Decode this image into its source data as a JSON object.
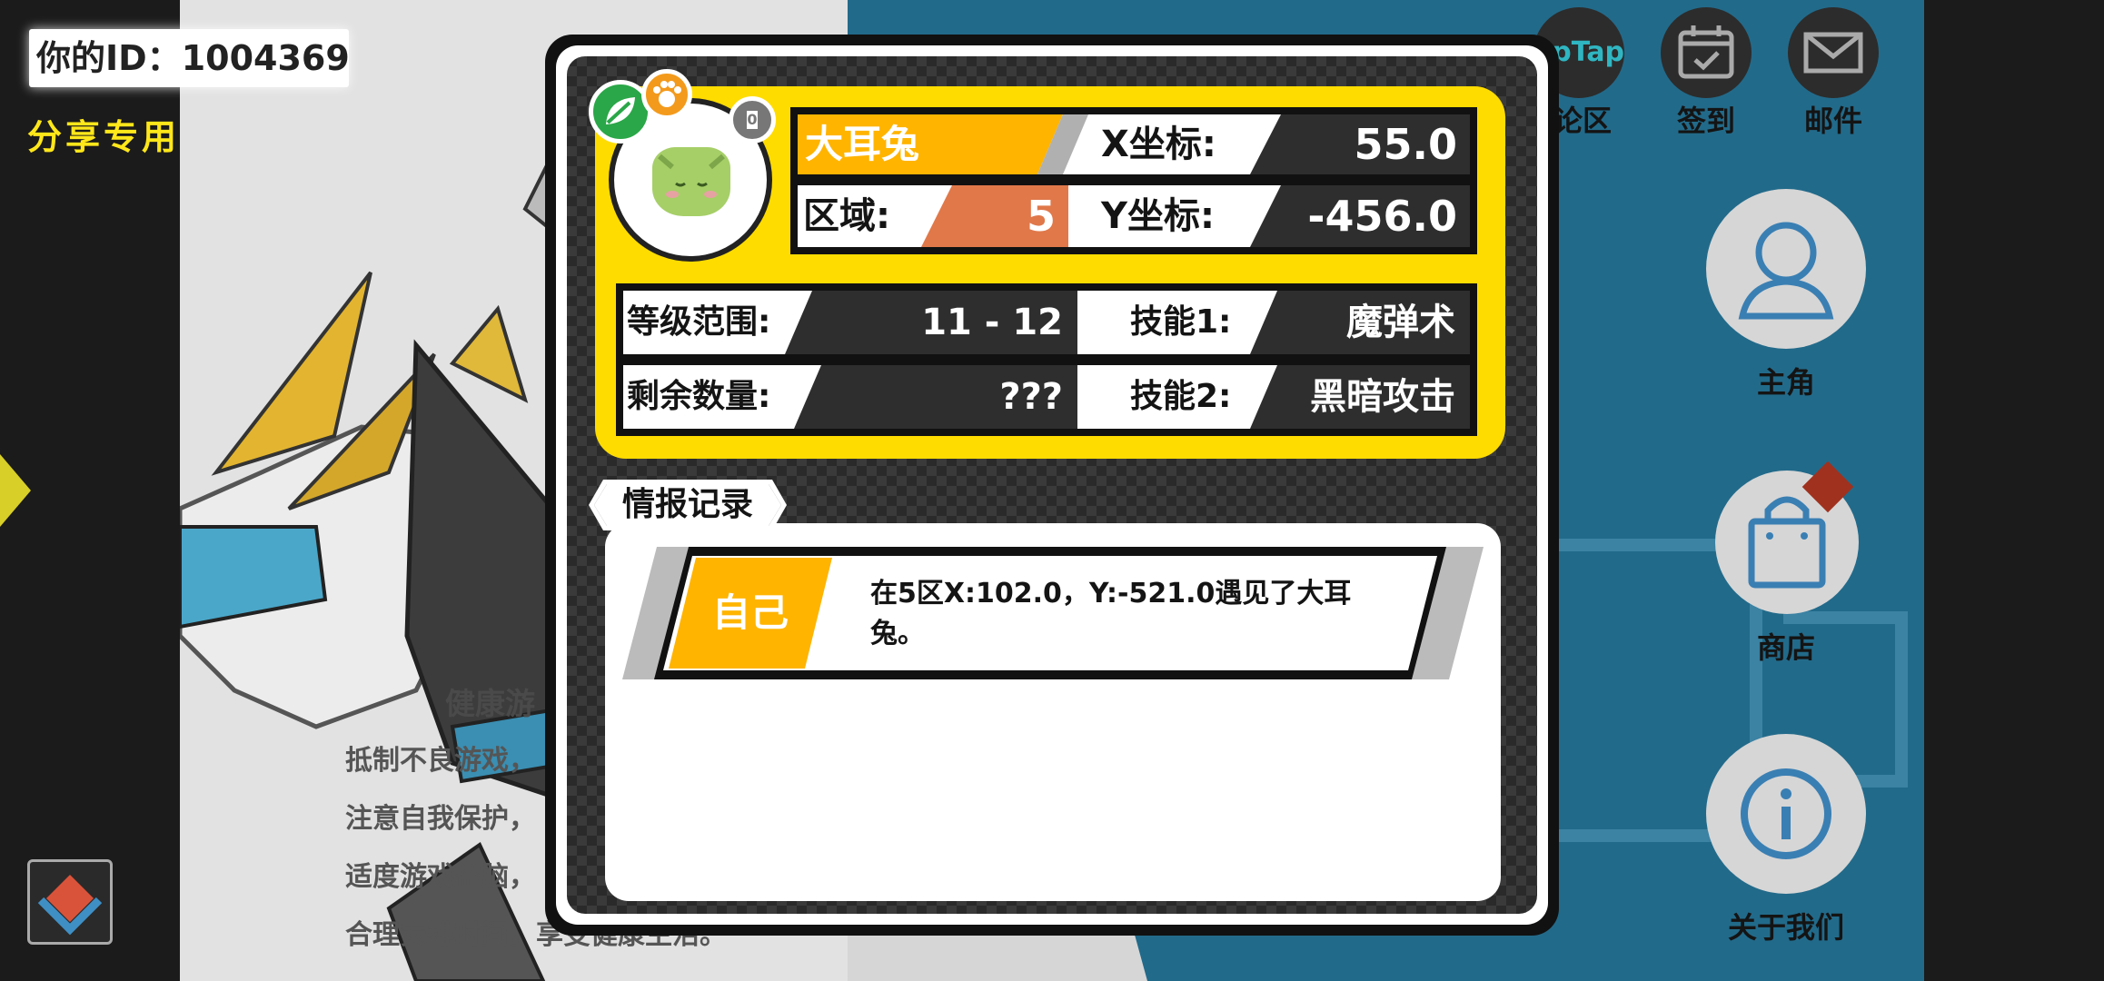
{
  "hud": {
    "player_id_label": "你的ID：",
    "player_id": "1004369",
    "share_label": "分享专用"
  },
  "background": {
    "warning_title": "健康游",
    "warning_lines": [
      "抵制不良游戏，",
      "注意自我保护，",
      "适度游戏益脑，",
      "合理安排时间，享受健康生活。"
    ]
  },
  "top_menu": {
    "items": [
      {
        "label": "论区",
        "icon": "taptap-icon",
        "icon_text": "apTap"
      },
      {
        "label": "签到",
        "icon": "calendar-check-icon"
      },
      {
        "label": "邮件",
        "icon": "mail-icon"
      }
    ]
  },
  "side_menu": {
    "items": [
      {
        "label": "主角",
        "icon": "person-icon"
      },
      {
        "label": "商店",
        "icon": "shopping-bag-icon"
      },
      {
        "label": "关于我们",
        "icon": "info-icon"
      }
    ]
  },
  "monster": {
    "name": "大耳兔",
    "x_label": "X坐标:",
    "x_value": "55.0",
    "region_label": "区域:",
    "region_value": "5",
    "y_label": "Y坐标:",
    "y_value": "-456.0",
    "level_label": "等级范围:",
    "level_value": "11 - 12",
    "skill1_label": "技能1:",
    "skill1_value": "魔弹术",
    "remaining_label": "剩余数量:",
    "remaining_value": "???",
    "skill2_label": "技能2:",
    "skill2_value": "黑暗攻击",
    "badge_number": "0"
  },
  "records": {
    "tab_label": "情报记录",
    "entries": [
      {
        "who": "自己",
        "text": "在5区X:102.0，Y:-521.0遇见了大耳兔。"
      }
    ]
  },
  "colors": {
    "card_yellow": "#ffdc00",
    "name_orange": "#ffb400",
    "region_orange": "#e0784a",
    "bg_blue": "#226a8a"
  }
}
